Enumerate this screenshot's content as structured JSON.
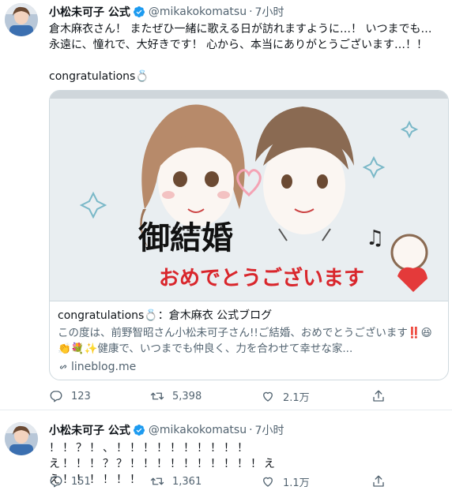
{
  "tweets": [
    {
      "name": "小松未可子 公式",
      "handle": "@mikakokomatsu",
      "separator": "·",
      "time": "7小时",
      "text": "倉木麻衣さん！ またぜひ一緒に歌える日が訪れますように…！ いつまでも…\n永遠に、憧れで、大好きです！ 心から、本当にありがとうございます…！！\n\ncongratulations💍",
      "card": {
        "image_texts": [
          "御結婚",
          "おめでとうございます"
        ],
        "title": "congratulations💍：倉木麻衣 公式ブログ",
        "description": "この度は、前野智昭さん小松未可子さん!!ご結婚、おめでとうございます‼️😆👏💐✨健康で、いつまでも仲良く、力を合わせて幸せな家...",
        "link": "lineblog.me"
      },
      "actions": {
        "reply": "123",
        "retweet": "5,398",
        "like": "2.1万",
        "share": ""
      }
    },
    {
      "name": "小松未可子 公式",
      "handle": "@mikakokomatsu",
      "separator": "·",
      "time": "7小时",
      "text": "！！？！、！！！！！！！！！！え！！！？？！！！！！！！！！！え\nえ！！！！！！",
      "actions": {
        "reply": "151",
        "retweet": "1,361",
        "like": "1.1万",
        "share": ""
      }
    }
  ],
  "colors": {
    "verified": "#1d9bf0",
    "text": "#0f1419",
    "secondary": "#536471",
    "border": "#cfd9de"
  },
  "icons": [
    "verified-badge-icon",
    "reply-icon",
    "retweet-icon",
    "like-icon",
    "share-icon",
    "link-icon"
  ]
}
